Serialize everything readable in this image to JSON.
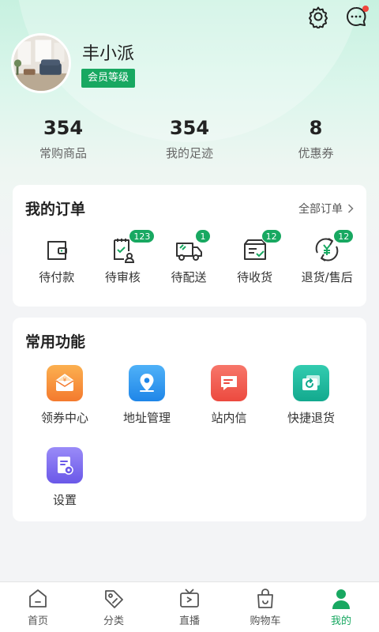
{
  "header": {
    "settings_icon": "gear-icon",
    "messages_icon": "chat-bubble-icon",
    "has_unread": true
  },
  "profile": {
    "name": "丰小派",
    "member_level": "会员等级"
  },
  "stats": [
    {
      "value": "354",
      "label": "常购商品"
    },
    {
      "value": "354",
      "label": "我的足迹"
    },
    {
      "value": "8",
      "label": "优惠券"
    }
  ],
  "orders": {
    "title": "我的订单",
    "all_link": "全部订单",
    "items": [
      {
        "label": "待付款",
        "icon": "wallet-icon",
        "badge": ""
      },
      {
        "label": "待审核",
        "icon": "clipboard-check-icon",
        "badge": "123"
      },
      {
        "label": "待配送",
        "icon": "delivery-truck-icon",
        "badge": "1"
      },
      {
        "label": "待收货",
        "icon": "package-receive-icon",
        "badge": "12"
      },
      {
        "label": "退货/售后",
        "icon": "refund-yuan-icon",
        "badge": "12"
      }
    ]
  },
  "functions": {
    "title": "常用功能",
    "items": [
      {
        "label": "领券中心",
        "icon": "coupon-icon",
        "color": "#f88a3a"
      },
      {
        "label": "地址管理",
        "icon": "location-pin-icon",
        "color": "#2d97f0"
      },
      {
        "label": "站内信",
        "icon": "message-icon",
        "color": "#f05b4f"
      },
      {
        "label": "快捷退货",
        "icon": "return-truck-icon",
        "color": "#1fb89c"
      },
      {
        "label": "设置",
        "icon": "settings-document-icon",
        "color": "#7c6cf0"
      }
    ]
  },
  "tabbar": {
    "items": [
      {
        "label": "首页",
        "icon": "home-icon"
      },
      {
        "label": "分类",
        "icon": "tag-icon"
      },
      {
        "label": "直播",
        "icon": "tv-icon"
      },
      {
        "label": "购物车",
        "icon": "shopping-bag-icon"
      },
      {
        "label": "我的",
        "icon": "user-icon"
      }
    ],
    "active_index": 4,
    "active_color": "#18a861"
  }
}
